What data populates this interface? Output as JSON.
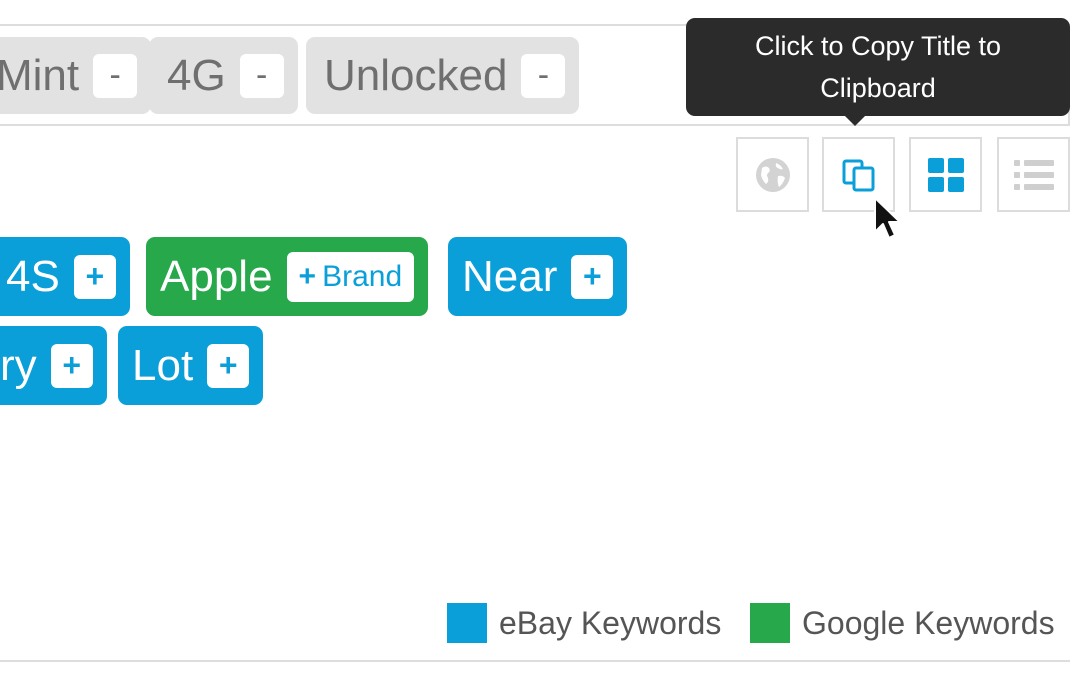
{
  "title_tags": [
    {
      "label": "Mint",
      "remove_label": "-"
    },
    {
      "label": "4G",
      "remove_label": "-"
    },
    {
      "label": "Unlocked",
      "remove_label": "-"
    }
  ],
  "tooltip": {
    "line1": "Click to Copy Title to",
    "line2": "Clipboard"
  },
  "toolbar": {
    "buttons": [
      {
        "icon": "globe-icon",
        "state": "disabled"
      },
      {
        "icon": "copy-icon",
        "state": "hover"
      },
      {
        "icon": "grid-view-icon",
        "state": "active"
      },
      {
        "icon": "list-view-icon",
        "state": "default"
      }
    ]
  },
  "keywords": {
    "row1": [
      {
        "label": "4S",
        "add_label": "+",
        "source": "ebay"
      },
      {
        "label": "Apple",
        "add_label": "+",
        "add_extra": "Brand",
        "source": "google"
      },
      {
        "label": "Near",
        "add_label": "+",
        "source": "ebay"
      }
    ],
    "row2": [
      {
        "label": "ry",
        "add_label": "+",
        "source": "ebay"
      },
      {
        "label": "Lot",
        "add_label": "+",
        "source": "ebay"
      }
    ]
  },
  "legend": {
    "ebay": {
      "label": "eBay Keywords",
      "color": "#0a9fd8"
    },
    "google": {
      "label": "Google Keywords",
      "color": "#26a84b"
    }
  },
  "colors": {
    "ebay_blue": "#0a9fd8",
    "google_green": "#26a84b",
    "tag_gray": "#e2e2e2",
    "tooltip_bg": "#2b2b2b"
  }
}
